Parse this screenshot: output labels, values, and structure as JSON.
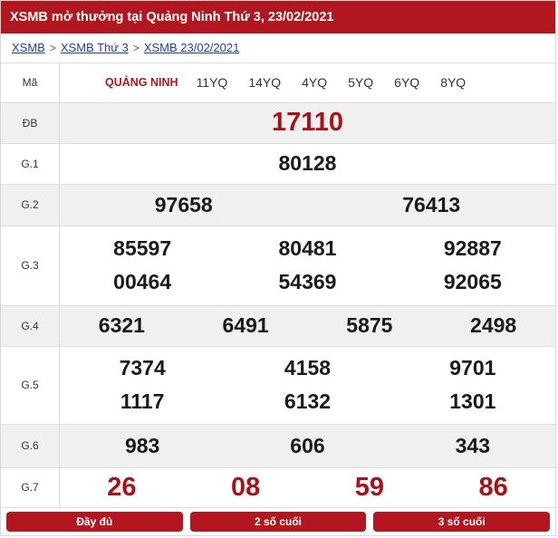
{
  "header": {
    "title": "XSMB mở thưởng tại Quảng Ninh Thứ 3, 23/02/2021"
  },
  "breadcrumb": {
    "items": [
      "XSMB",
      "XSMB Thứ 3",
      "XSMB 23/02/2021"
    ],
    "separator": ">"
  },
  "table": {
    "code_row": {
      "label": "Mã",
      "province": "QUẢNG NINH",
      "codes": [
        "11YQ",
        "14YQ",
        "4YQ",
        "5YQ",
        "6YQ",
        "8YQ"
      ]
    },
    "db": {
      "label": "ĐB",
      "value": "17110"
    },
    "g1": {
      "label": "G.1",
      "values": [
        "80128"
      ]
    },
    "g2": {
      "label": "G.2",
      "values": [
        "97658",
        "76413"
      ]
    },
    "g3": {
      "label": "G.3",
      "values": [
        "85597",
        "80481",
        "92887",
        "00464",
        "54369",
        "92065"
      ]
    },
    "g4": {
      "label": "G.4",
      "values": [
        "6321",
        "6491",
        "5875",
        "2498"
      ]
    },
    "g5": {
      "label": "G.5",
      "values": [
        "7374",
        "4158",
        "9701",
        "1117",
        "6132",
        "1301"
      ]
    },
    "g6": {
      "label": "G.6",
      "values": [
        "983",
        "606",
        "343"
      ]
    },
    "g7": {
      "label": "G.7",
      "values": [
        "26",
        "08",
        "59",
        "86"
      ]
    }
  },
  "footer": {
    "buttons": [
      "Đầy đủ",
      "2 số cuối",
      "3 số cuối"
    ]
  },
  "colors": {
    "accent": "#b2161e",
    "special_prize": "#a5141a",
    "link": "#1f3f9f",
    "row_alt": "#f0f0f0"
  }
}
